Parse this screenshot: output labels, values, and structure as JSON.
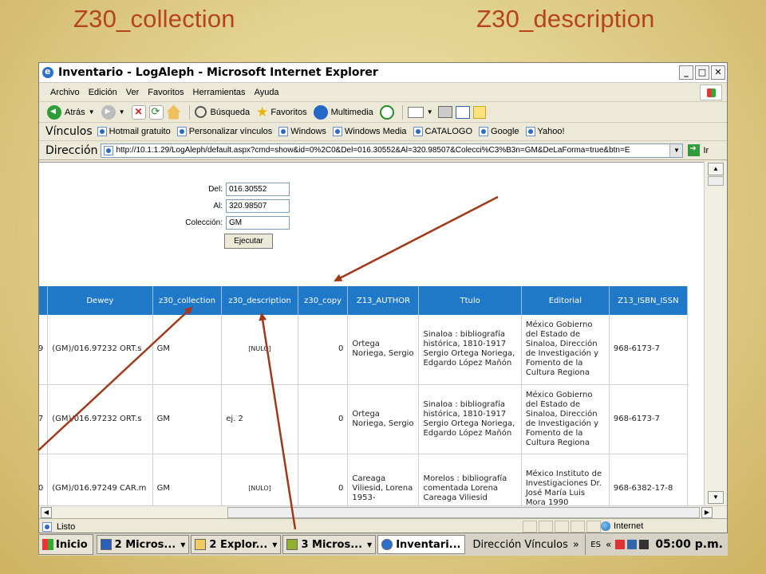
{
  "slide": {
    "title_left": "Z30_collection",
    "title_right": "Z30_description"
  },
  "window": {
    "title": "Inventario - LogAleph - Microsoft Internet Explorer",
    "controls": [
      "_",
      "□",
      "✕"
    ]
  },
  "menu": [
    "Archivo",
    "Edición",
    "Ver",
    "Favoritos",
    "Herramientas",
    "Ayuda"
  ],
  "toolbar": {
    "back": "Atrás",
    "search": "Búsqueda",
    "favorites": "Favoritos",
    "multimedia": "Multimedia"
  },
  "links": {
    "label": "Vínculos",
    "items": [
      "Hotmail gratuito",
      "Personalizar vínculos",
      "Windows",
      "Windows Media",
      "CATALOGO",
      "Google",
      "Yahoo!"
    ]
  },
  "address": {
    "label": "Dirección",
    "url": "http://10.1.1.29/LogAleph/default.aspx?cmd=show&id=0%2C0&Del=016.30552&Al=320.98507&Colecci%C3%B3n=GM&DeLaForma=true&btn=E",
    "go": "Ir"
  },
  "form": {
    "del_label": "Del:",
    "del_value": "016.30552",
    "al_label": "Al:",
    "al_value": "320.98507",
    "coleccion_label": "Colección:",
    "coleccion_value": "GM",
    "execute": "Ejecutar"
  },
  "table": {
    "headers": [
      "Dewey",
      "z30_collection",
      "z30_description",
      "z30_copy",
      "Z13_AUTHOR",
      "Ttulo",
      "Editorial",
      "Z13_ISBN_ISSN"
    ],
    "rows": [
      {
        "idx": "9",
        "dewey": "(GM)/016.97232 ORT.s",
        "collection": "GM",
        "description": "[NULO]",
        "copy": "0",
        "author": "Ortega Noriega, Sergio",
        "title": "Sinaloa : bibliografía histórica, 1810-1917 Sergio Ortega Noriega, Edgardo López Mañón",
        "editorial": "México Gobierno del Estado de Sinaloa, Dirección de Investigación y Fomento de la Cultura Regiona",
        "isbn": "968-6173-7"
      },
      {
        "idx": "7",
        "dewey": "(GM)/016.97232 ORT.s",
        "collection": "GM",
        "description": "ej. 2",
        "copy": "0",
        "author": "Ortega Noriega, Sergio",
        "title": "Sinaloa : bibliografía histórica, 1810-1917 Sergio Ortega Noriega, Edgardo López Mañón",
        "editorial": "México Gobierno del Estado de Sinaloa, Dirección de Investigación y Fomento de la Cultura Regiona",
        "isbn": "968-6173-7"
      },
      {
        "idx": "0",
        "dewey": "(GM)/016.97249 CAR.m",
        "collection": "GM",
        "description": "[NULO]",
        "copy": "0",
        "author": "Careaga Viliesid, Lorena 1953-",
        "title": "Morelos : bibliografía comentada Lorena Careaga Viliesid",
        "editorial": "México Instituto de Investigaciones Dr. José María Luis Mora 1990",
        "isbn": "968-6382-17-8"
      }
    ]
  },
  "status": {
    "text": "Listo",
    "zone": "Internet"
  },
  "taskbar": {
    "start": "Inicio",
    "buttons": [
      "2 Micros...",
      "2 Explor...",
      "3 Micros...",
      "Inventari..."
    ],
    "links": "Dirección  Vínculos",
    "more": "»",
    "lang": "ES",
    "clock": "05:00 p.m."
  },
  "colors": {
    "title_red": "#b5441c",
    "header_blue": "#1f78c8",
    "arrow": "#a0391a"
  }
}
